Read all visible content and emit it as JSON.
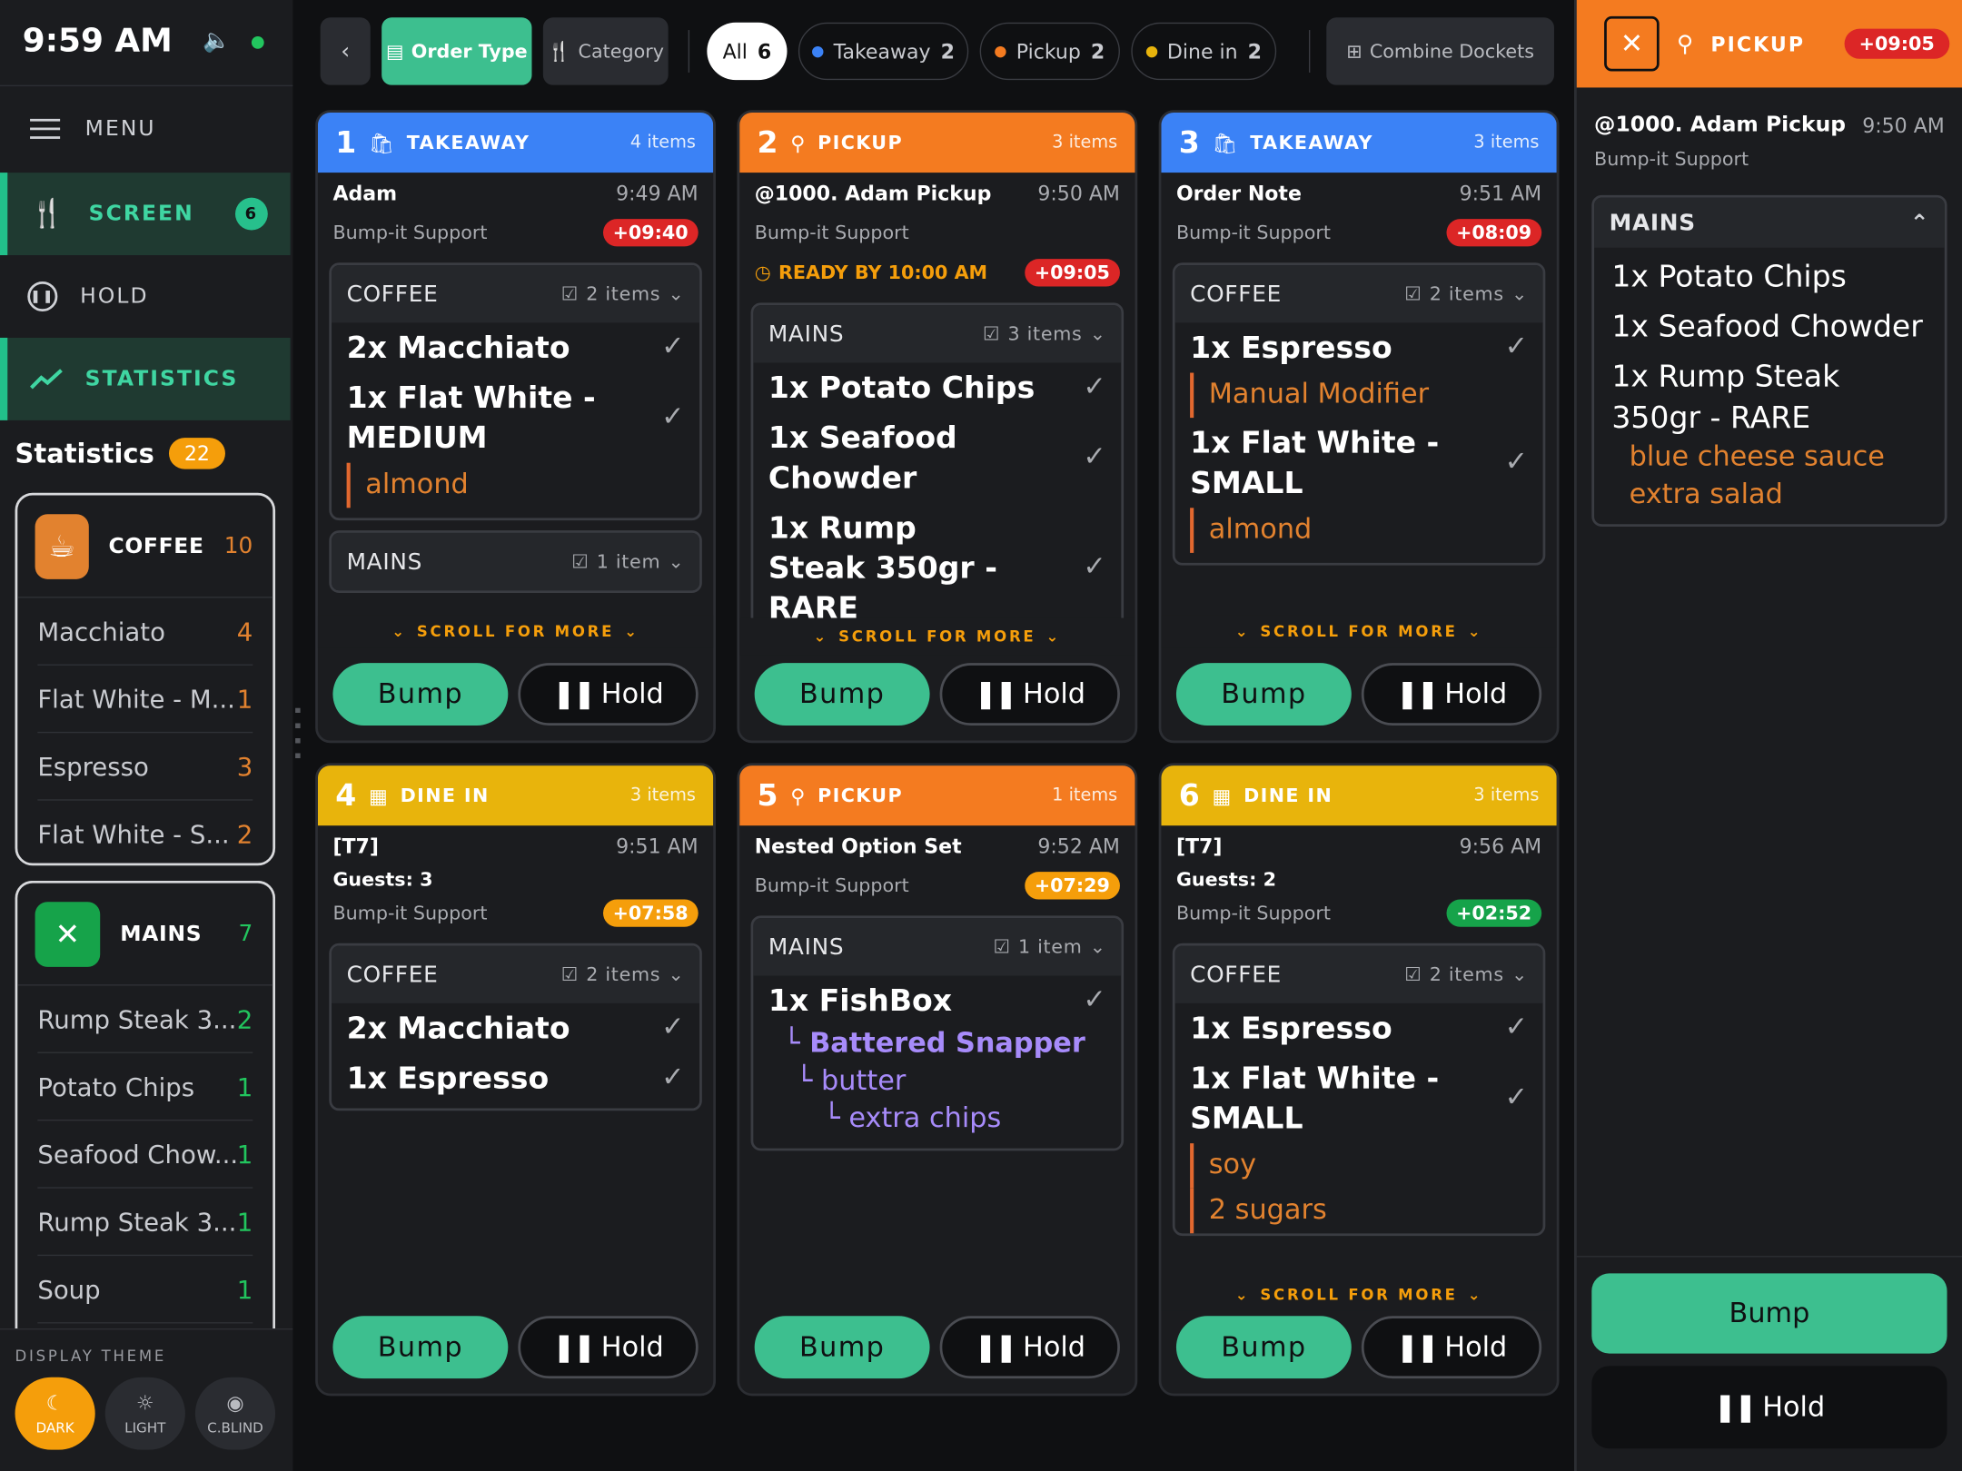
{
  "status": {
    "time": "9:59 AM"
  },
  "sidebar": {
    "menu_label": "MENU",
    "nav": [
      {
        "label": "SCREEN",
        "badge": "6"
      },
      {
        "label": "HOLD"
      },
      {
        "label": "STATISTICS"
      }
    ],
    "stats_title": "Statistics",
    "stats_count": "22",
    "groups": [
      {
        "name": "COFFEE",
        "count": "10",
        "color": "#e2822f",
        "rows": [
          {
            "label": "Macchiato",
            "qty": "4"
          },
          {
            "label": "Flat White - M...",
            "qty": "1"
          },
          {
            "label": "Espresso",
            "qty": "3"
          },
          {
            "label": "Flat White - S...",
            "qty": "2"
          }
        ]
      },
      {
        "name": "MAINS",
        "count": "7",
        "color": "#16a34a",
        "rows": [
          {
            "label": "Rump Steak 3...",
            "qty": "2"
          },
          {
            "label": "Potato Chips",
            "qty": "1"
          },
          {
            "label": "Seafood Chow...",
            "qty": "1"
          },
          {
            "label": "Rump Steak 3...",
            "qty": "1"
          },
          {
            "label": "Soup",
            "qty": "1"
          }
        ]
      }
    ],
    "theme_label": "DISPLAY THEME",
    "themes": [
      "DARK",
      "LIGHT",
      "C.BLIND"
    ]
  },
  "toolbar": {
    "order_type": "Order Type",
    "category": "Category",
    "all": "All",
    "all_count": "6",
    "takeaway": "Takeaway",
    "takeaway_count": "2",
    "pickup": "Pickup",
    "pickup_count": "2",
    "dinein": "Dine in",
    "dinein_count": "2",
    "combine": "Combine Dockets"
  },
  "common": {
    "bump": "Bump",
    "hold": "Hold",
    "scroll": "SCROLL FOR MORE"
  },
  "colors": {
    "takeaway": "#3b82f6",
    "pickup": "#f47b20",
    "dinein": "#e8b40c",
    "bump": "#3dbf8f"
  },
  "orders": [
    {
      "num": "1",
      "type": "TAKEAWAY",
      "items": "4 items",
      "name": "Adam",
      "time": "9:49 AM",
      "sub": "Bump-it Support",
      "timer": "+09:40",
      "g1": {
        "name": "COFFEE",
        "count": "2 items",
        "i1": "2x Macchiato",
        "i2": "1x Flat White - MEDIUM",
        "m2": "almond"
      },
      "g2": {
        "name": "MAINS",
        "count": "1 item"
      }
    },
    {
      "num": "2",
      "type": "PICKUP",
      "items": "3 items",
      "name": "@1000. Adam Pickup",
      "time": "9:50 AM",
      "sub": "Bump-it Support",
      "ready": "READY BY 10:00 AM",
      "timer": "+09:05",
      "g1": {
        "name": "MAINS",
        "count": "3 items",
        "i1": "1x Potato Chips",
        "i2": "1x Seafood Chowder",
        "i3": "1x Rump Steak 350gr - RARE"
      }
    },
    {
      "num": "3",
      "type": "TAKEAWAY",
      "items": "3 items",
      "name": "Order Note",
      "time": "9:51 AM",
      "sub": "Bump-it Support",
      "timer": "+08:09",
      "g1": {
        "name": "COFFEE",
        "count": "2 items",
        "i1": "1x Espresso",
        "m1": "Manual Modifier",
        "i2": "1x Flat White - SMALL",
        "m2": "almond"
      }
    },
    {
      "num": "4",
      "type": "DINE IN",
      "items": "3 items",
      "name": "[T7]",
      "time": "9:51 AM",
      "guests": "Guests:  3",
      "sub": "Bump-it Support",
      "timer": "+07:58",
      "g1": {
        "name": "COFFEE",
        "count": "2 items",
        "i1": "2x Macchiato",
        "i2": "1x Espresso"
      }
    },
    {
      "num": "5",
      "type": "PICKUP",
      "items": "1 items",
      "name": "Nested Option Set",
      "time": "9:52 AM",
      "sub": "Bump-it Support",
      "timer": "+07:29",
      "g1": {
        "name": "MAINS",
        "count": "1 item",
        "i1": "1x FishBox",
        "o1": "Battered Snapper",
        "o2": "butter",
        "o3": "extra chips"
      }
    },
    {
      "num": "6",
      "type": "DINE IN",
      "items": "3 items",
      "name": "[T7]",
      "time": "9:56 AM",
      "guests": "Guests:  2",
      "sub": "Bump-it Support",
      "timer": "+02:52",
      "g1": {
        "name": "COFFEE",
        "count": "2 items",
        "i1": "1x Espresso",
        "i2": "1x Flat White - SMALL",
        "m2a": "soy",
        "m2b": "2 sugars"
      }
    }
  ],
  "panel": {
    "type": "PICKUP",
    "timer": "+09:05",
    "name": "@1000. Adam Pickup",
    "time": "9:50 AM",
    "sub": "Bump-it Support",
    "group": "MAINS",
    "i1": "1x Potato Chips",
    "i2": "1x Seafood Chowder",
    "i3": "1x Rump Steak 350gr - RARE",
    "m3a": "blue cheese sauce",
    "m3b": "extra salad"
  }
}
